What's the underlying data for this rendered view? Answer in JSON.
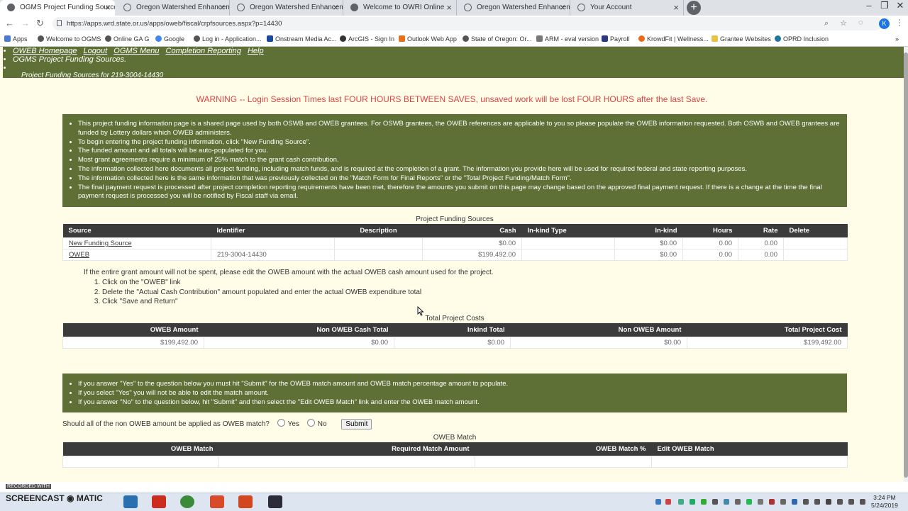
{
  "tabs": [
    {
      "label": "OGMS Project Funding Sources",
      "active": true
    },
    {
      "label": "Oregon Watershed Enhancemen",
      "active": false
    },
    {
      "label": "Oregon Watershed Enhancemen",
      "active": false
    },
    {
      "label": "Welcome to OWRI Online",
      "active": false
    },
    {
      "label": "Oregon Watershed Enhancemen",
      "active": false
    },
    {
      "label": "Your Account",
      "active": false
    }
  ],
  "address_bar": {
    "url": "https://apps.wrd.state.or.us/apps/oweb/fiscal/crpfsources.aspx?p=14430",
    "profile_initial": "K"
  },
  "bookmarks": [
    "Apps",
    "Welcome to OGMS",
    "Online GA G",
    "Google",
    "Log in - Application...",
    "Onstream Media Ac...",
    "ArcGIS - Sign In",
    "Outlook Web App",
    "State of Oregon: Or...",
    "ARM - eval version",
    "Payroll",
    "KrowdFit | Wellness...",
    "Grantee Websites",
    "OPRD Inclusion"
  ],
  "nav": {
    "links": [
      "OWEB Homepage",
      "Logout",
      "OGMS Menu",
      "Completion Reporting",
      "Help"
    ],
    "subtitle": "OGMS Project Funding Sources.",
    "breadcrumb": "Project Funding Sources for 219-3004-14430"
  },
  "warning": "WARNING -- Login Session Times last FOUR HOURS BETWEEN SAVES, unsaved work will be lost FOUR HOURS after the last Save.",
  "info_bullets": [
    "This project funding information page is a shared page used by both OSWB and OWEB grantees. For OSWB grantees, the OWEB references are applicable to you so please populate the OWEB information requested. Both OSWB and OWEB grantees are funded by Lottery dollars which OWEB administers.",
    "To begin entering the project funding information, click \"New Funding Source\".",
    "The funded amount and all totals will be auto-populated for you.",
    "Most grant agreements require a minimum of 25% match to the grant cash contribution.",
    "The information collected here documents all project funding, including match funds, and is required at the completion of a grant. The information you provide here will be used for required federal and state reporting purposes.",
    "The information collected here is the same information that was previously collected on the \"Match Form for Final Reports\" or the \"Total Project Funding/Match Form\".",
    "The final payment request is processed after project completion reporting requirements have been met, therefore the amounts you submit on this page may change based on the approved final payment request. If there is a change at the time the final payment request is processed you will be notified by Fiscal staff via email."
  ],
  "funding": {
    "title": "Project Funding Sources",
    "headers": [
      "Source",
      "Identifier",
      "Description",
      "Cash",
      "In-kind Type",
      "In-kind",
      "Hours",
      "Rate",
      "Delete"
    ],
    "rows": [
      {
        "source": "New Funding Source",
        "identifier": "",
        "description": "",
        "cash": "$0.00",
        "inkind_type": "",
        "inkind": "$0.00",
        "hours": "0.00",
        "rate": "0.00",
        "delete": ""
      },
      {
        "source": "OWEB",
        "identifier": "219-3004-14430",
        "description": "",
        "cash": "$199,492.00",
        "inkind_type": "",
        "inkind": "$0.00",
        "hours": "0.00",
        "rate": "0.00",
        "delete": ""
      }
    ]
  },
  "instructions": {
    "intro": "If the entire grant amount will not be spent, please edit the OWEB amount with the actual OWEB cash amount used for the project.",
    "steps": [
      "Click on the \"OWEB\" link",
      "Delete the \"Actual Cash Contribution\" amount populated and enter the actual OWEB expenditure total",
      "Click \"Save and Return\""
    ]
  },
  "totals": {
    "title": "Total Project Costs",
    "headers": [
      "OWEB Amount",
      "Non OWEB Cash Total",
      "Inkind Total",
      "Non OWEB Amount",
      "Total Project Cost"
    ],
    "values": [
      "$199,492.00",
      "$0.00",
      "$0.00",
      "$0.00",
      "$199,492.00"
    ]
  },
  "match_bullets": [
    "If you answer \"Yes\" to the question below you must hit \"Submit\" for the OWEB match amount and OWEB match percentage amount to populate.",
    "If you select \"Yes\" you will not be able to edit the match amount.",
    "If you answer \"No\" to the question below, hit \"Submit\" and then select the \"Edit OWEB Match\" link and enter the OWEB match amount."
  ],
  "question": {
    "text": "Should all of the non OWEB amount be applied as OWEB match?",
    "yes": "Yes",
    "no": "No",
    "submit": "Submit"
  },
  "match_table": {
    "title": "OWEB Match",
    "headers": [
      "OWEB Match",
      "Required Match Amount",
      "OWEB Match %",
      "Edit OWEB Match"
    ]
  },
  "taskbar": {
    "time": "3:24 PM",
    "date": "5/24/2019",
    "watermark_small": "RECORDED WITH",
    "watermark_big": "SCREENCAST ◉ MATIC"
  },
  "colors": {
    "page_bg": "#fffde8",
    "panel_green": "#5e7036",
    "header_dark": "#3b3b3b",
    "warning_red": "#dd4444"
  }
}
